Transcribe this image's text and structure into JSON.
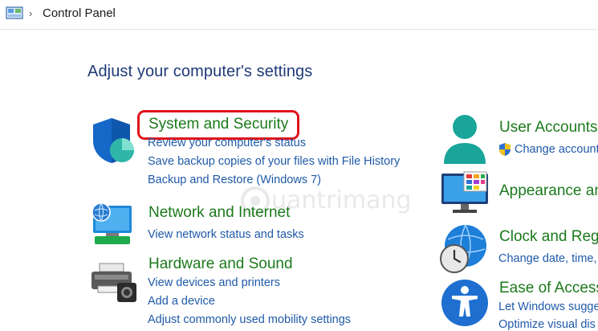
{
  "address_bar": {
    "separator": "›",
    "breadcrumb": "Control Panel"
  },
  "heading": "Adjust your computer's settings",
  "left_column": [
    {
      "title": "System and Security",
      "icon": "shield-icon",
      "links": [
        "Review your computer's status",
        "Save backup copies of your files with File History",
        "Backup and Restore (Windows 7)"
      ]
    },
    {
      "title": "Network and Internet",
      "icon": "network-globe-icon",
      "links": [
        "View network status and tasks"
      ]
    },
    {
      "title": "Hardware and Sound",
      "icon": "printer-icon",
      "links": [
        "View devices and printers",
        "Add a device",
        "Adjust commonly used mobility settings"
      ]
    }
  ],
  "right_column": [
    {
      "title": "User Accounts",
      "icon": "user-icon",
      "links": [
        "Change account"
      ]
    },
    {
      "title": "Appearance an",
      "icon": "monitor-icon",
      "links": []
    },
    {
      "title": "Clock and Reg",
      "icon": "clock-globe-icon",
      "links": [
        "Change date, time,"
      ]
    },
    {
      "title": "Ease of Access",
      "icon": "accessibility-icon",
      "links": [
        "Let Windows sugge",
        "Optimize visual dis"
      ]
    }
  ],
  "watermark": "uantrimang",
  "colors": {
    "heading": "#1e3a78",
    "category": "#1c7a1c",
    "link": "#1f5aa8",
    "highlight": "#e0141c"
  }
}
